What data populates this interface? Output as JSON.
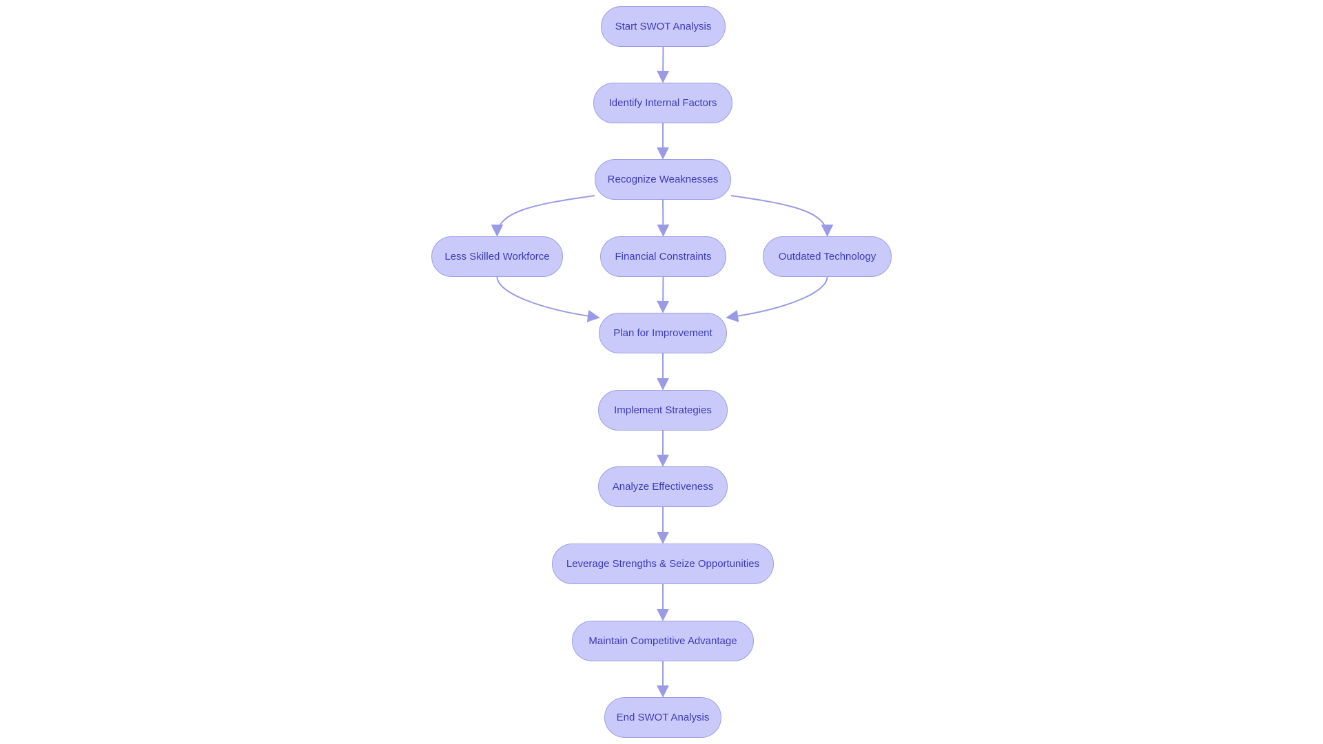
{
  "diagram": {
    "type": "flowchart",
    "direction": "top-down",
    "colors": {
      "node_fill": "#cacafa",
      "node_stroke": "#9d9de6",
      "edge": "#9a9ae6",
      "text": "#3a3ab8"
    },
    "nodes": [
      {
        "id": "start",
        "label": "Start SWOT Analysis"
      },
      {
        "id": "identify",
        "label": "Identify Internal Factors"
      },
      {
        "id": "recognize",
        "label": "Recognize Weaknesses"
      },
      {
        "id": "workforce",
        "label": "Less Skilled Workforce"
      },
      {
        "id": "financial",
        "label": "Financial Constraints"
      },
      {
        "id": "tech",
        "label": "Outdated Technology"
      },
      {
        "id": "plan",
        "label": "Plan for Improvement"
      },
      {
        "id": "implement",
        "label": "Implement Strategies"
      },
      {
        "id": "analyze",
        "label": "Analyze Effectiveness"
      },
      {
        "id": "leverage",
        "label": "Leverage Strengths & Seize Opportunities"
      },
      {
        "id": "maintain",
        "label": "Maintain Competitive Advantage"
      },
      {
        "id": "end",
        "label": "End SWOT Analysis"
      }
    ],
    "edges": [
      {
        "from": "start",
        "to": "identify"
      },
      {
        "from": "identify",
        "to": "recognize"
      },
      {
        "from": "recognize",
        "to": "workforce"
      },
      {
        "from": "recognize",
        "to": "financial"
      },
      {
        "from": "recognize",
        "to": "tech"
      },
      {
        "from": "workforce",
        "to": "plan"
      },
      {
        "from": "financial",
        "to": "plan"
      },
      {
        "from": "tech",
        "to": "plan"
      },
      {
        "from": "plan",
        "to": "implement"
      },
      {
        "from": "implement",
        "to": "analyze"
      },
      {
        "from": "analyze",
        "to": "leverage"
      },
      {
        "from": "leverage",
        "to": "maintain"
      },
      {
        "from": "maintain",
        "to": "end"
      }
    ]
  }
}
